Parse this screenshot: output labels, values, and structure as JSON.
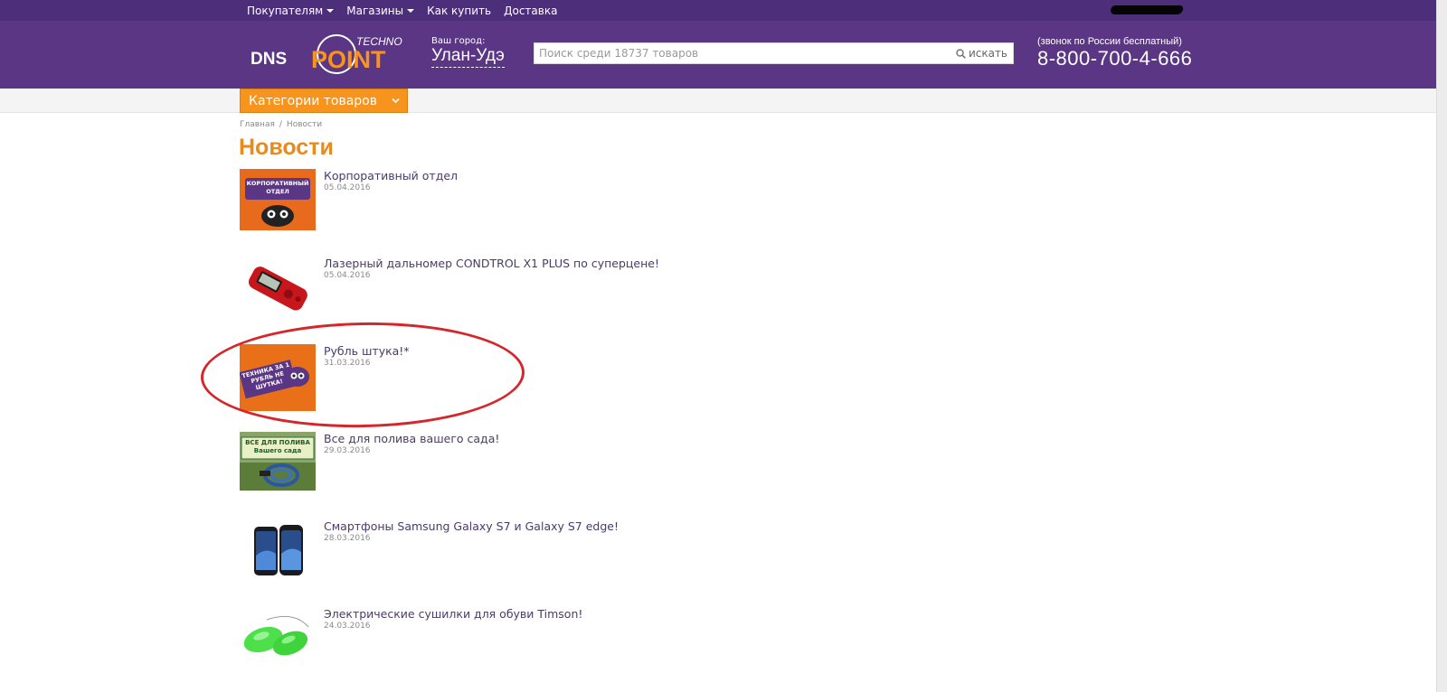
{
  "topnav": {
    "items": [
      {
        "label": "Покупателям",
        "has_caret": true
      },
      {
        "label": "Магазины",
        "has_caret": true
      },
      {
        "label": "Как купить",
        "has_caret": false
      },
      {
        "label": "Доставка",
        "has_caret": false
      }
    ]
  },
  "header": {
    "logo": {
      "text_left": "DNS",
      "text_main": "POINT",
      "text_small": "TECHNO"
    },
    "city": {
      "caption": "Ваш город:",
      "name": "Улан-Удэ"
    },
    "search": {
      "placeholder": "Поиск среди 18737 товаров",
      "value": "",
      "button_label": "искать",
      "icon": "search-icon"
    },
    "phone": {
      "note": "(звонок по России бесплатный)",
      "number": "8-800-700-4-666"
    }
  },
  "categories": {
    "label": "Категории товаров",
    "icon": "chevron-down-icon"
  },
  "breadcrumb": {
    "home": "Главная",
    "separator": "/",
    "current": "Новости"
  },
  "page": {
    "title": "Новости"
  },
  "news": [
    {
      "title": "Корпоративный отдел",
      "date": "05.04.2016",
      "thumb_text": "КОРПОРАТИВНЫЙ ОТДЕЛ"
    },
    {
      "title": "Лазерный дальномер CONDTROL X1 PLUS по суперцене!",
      "date": "05.04.2016",
      "thumb_text": ""
    },
    {
      "title": "Рубль штука!*",
      "date": "31.03.2016",
      "thumb_text": "ТЕХНИКА ЗА 1 РУБЛЬ НЕ ШУТКА!"
    },
    {
      "title": "Все для полива вашего сада!",
      "date": "29.03.2016",
      "thumb_text": "ВСЕ ДЛЯ ПОЛИВА Вашего сада"
    },
    {
      "title": "Смартфоны Samsung Galaxy S7 и Galaxy S7 edge!",
      "date": "28.03.2016",
      "thumb_text": ""
    },
    {
      "title": "Электрические сушилки для обуви Timson!",
      "date": "24.03.2016",
      "thumb_text": ""
    }
  ],
  "colors": {
    "topbar": "#4d2e7a",
    "header": "#5a3685",
    "accent_orange": "#f7941d",
    "title_orange": "#e88a1e",
    "highlight_red": "#d4262b"
  }
}
